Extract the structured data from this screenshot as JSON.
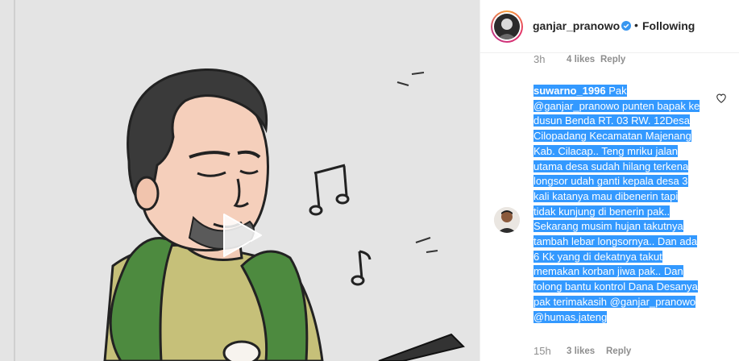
{
  "post": {
    "username": "ganjar_pranowo",
    "separator": "•",
    "follow_status": "Following"
  },
  "previous_comment": {
    "time": "3h",
    "likes": "4 likes",
    "reply": "Reply"
  },
  "comment": {
    "username": "suwarno_1996",
    "text": " Pak @ganjar_pranowo punten bapak ke dusun Benda RT. 03 RW. 12Desa Cilopadang Kecamatan Majenang Kab. Cilacap.. Teng mriku jalan utama desa sudah hilang terkena longsor udah ganti kepala desa 3 kali katanya mau dibenerin tapi tidak kunjung di benerin pak.. Sekarang musim hujan takutnya tambah lebar longsornya.. Dan ada 6 Kk yang di dekatnya takut memakan korban jiwa pak.. Dan tolong bantu kontrol Dana Desanya pak terimakasih @ganjar_pranowo @humas.jateng",
    "time": "15h",
    "likes": "3 likes",
    "reply": "Reply"
  },
  "icons": {
    "verified": "verified-badge-icon",
    "heart": "heart-outline-icon",
    "play": "play-icon"
  },
  "colors": {
    "selection": "#3399ff",
    "verified": "#3897f0",
    "meta": "#8e8e8e",
    "text": "#262626"
  }
}
